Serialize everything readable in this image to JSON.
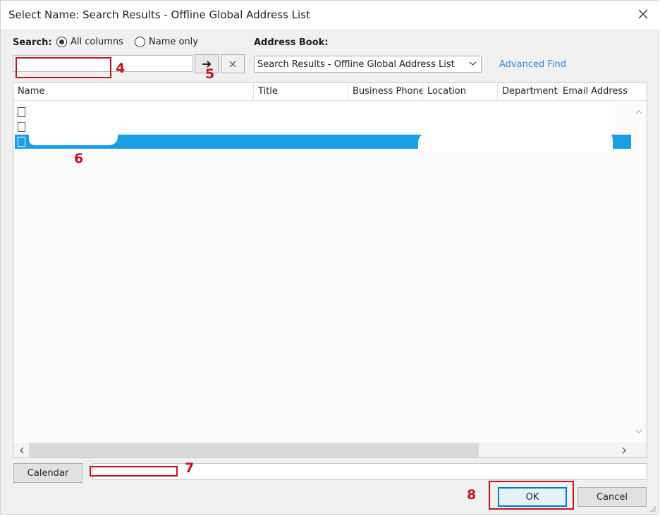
{
  "window": {
    "title": "Select Name: Search Results - Offline Global Address List"
  },
  "search": {
    "label": "Search:",
    "options": [
      {
        "label": "All columns",
        "selected": true
      },
      {
        "label": "Name only",
        "selected": false
      }
    ],
    "value": "",
    "go_icon": "arrow-right-icon",
    "clear_icon": "close-icon"
  },
  "address_book": {
    "label": "Address Book:",
    "selected": "Search Results - Offline Global Address List",
    "advanced_find": "Advanced Find"
  },
  "list": {
    "columns": [
      "Name",
      "Title",
      "Business Phone",
      "Location",
      "Department",
      "Email Address"
    ],
    "rows": [
      {
        "selected": false
      },
      {
        "selected": false
      },
      {
        "selected": true
      }
    ]
  },
  "footer": {
    "calendar_button": "Calendar",
    "ok_button": "OK",
    "cancel_button": "Cancel"
  },
  "annotations": [
    "4",
    "5",
    "6",
    "7",
    "8"
  ],
  "colors": {
    "accent": "#0078d7",
    "selection": "#1a9fe4",
    "annotation": "#c1121f",
    "link": "#2b88d8"
  }
}
